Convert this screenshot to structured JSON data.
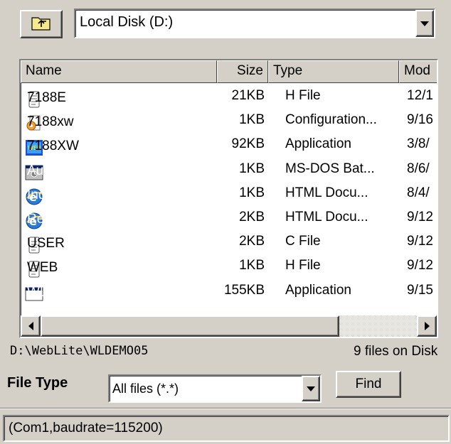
{
  "toolbar": {
    "up_icon": "folder-up-icon"
  },
  "drive": {
    "selected": "Local Disk (D:)"
  },
  "columns": [
    "Name",
    "Size",
    "Type",
    "Mod"
  ],
  "files": [
    {
      "name": "7188E",
      "size": "21KB",
      "type": "H File",
      "mod": "12/1",
      "icon": "text-file-icon",
      "selected": false
    },
    {
      "name": "7188xw",
      "size": "1KB",
      "type": "Configuration...",
      "mod": "9/16",
      "icon": "config-file-icon",
      "selected": false
    },
    {
      "name": "7188XW",
      "size": "92KB",
      "type": "Application",
      "mod": "3/8/",
      "icon": "application-icon",
      "selected": false
    },
    {
      "name": "Autoexec",
      "size": "1KB",
      "type": "MS-DOS Bat...",
      "mod": "8/6/",
      "icon": "batch-file-icon",
      "selected": true
    },
    {
      "name": "Index",
      "size": "1KB",
      "type": "HTML Docu...",
      "mod": "8/4/",
      "icon": "ie-document-icon",
      "selected": true
    },
    {
      "name": "Refresh",
      "size": "2KB",
      "type": "HTML Docu...",
      "mod": "9/12",
      "icon": "ie-document-icon",
      "selected": true
    },
    {
      "name": "USER",
      "size": "2KB",
      "type": "C File",
      "mod": "9/12",
      "icon": "text-file-icon",
      "selected": false
    },
    {
      "name": "WEB",
      "size": "1KB",
      "type": "H File",
      "mod": "9/12",
      "icon": "text-file-icon",
      "selected": false
    },
    {
      "name": "WLDEMO05",
      "size": "155KB",
      "type": "Application",
      "mod": "9/15",
      "icon": "window-app-icon",
      "selected": true
    }
  ],
  "path": "D:\\WebLite\\WLDEMO05",
  "file_count": "9 files on Disk",
  "file_type": {
    "label": "File Type",
    "selected": "All files (*.*)"
  },
  "find_label": "Find",
  "status": "(Com1,baudrate=115200)",
  "colors": {
    "selection": "#0a246a",
    "face": "#d4d0c8"
  }
}
